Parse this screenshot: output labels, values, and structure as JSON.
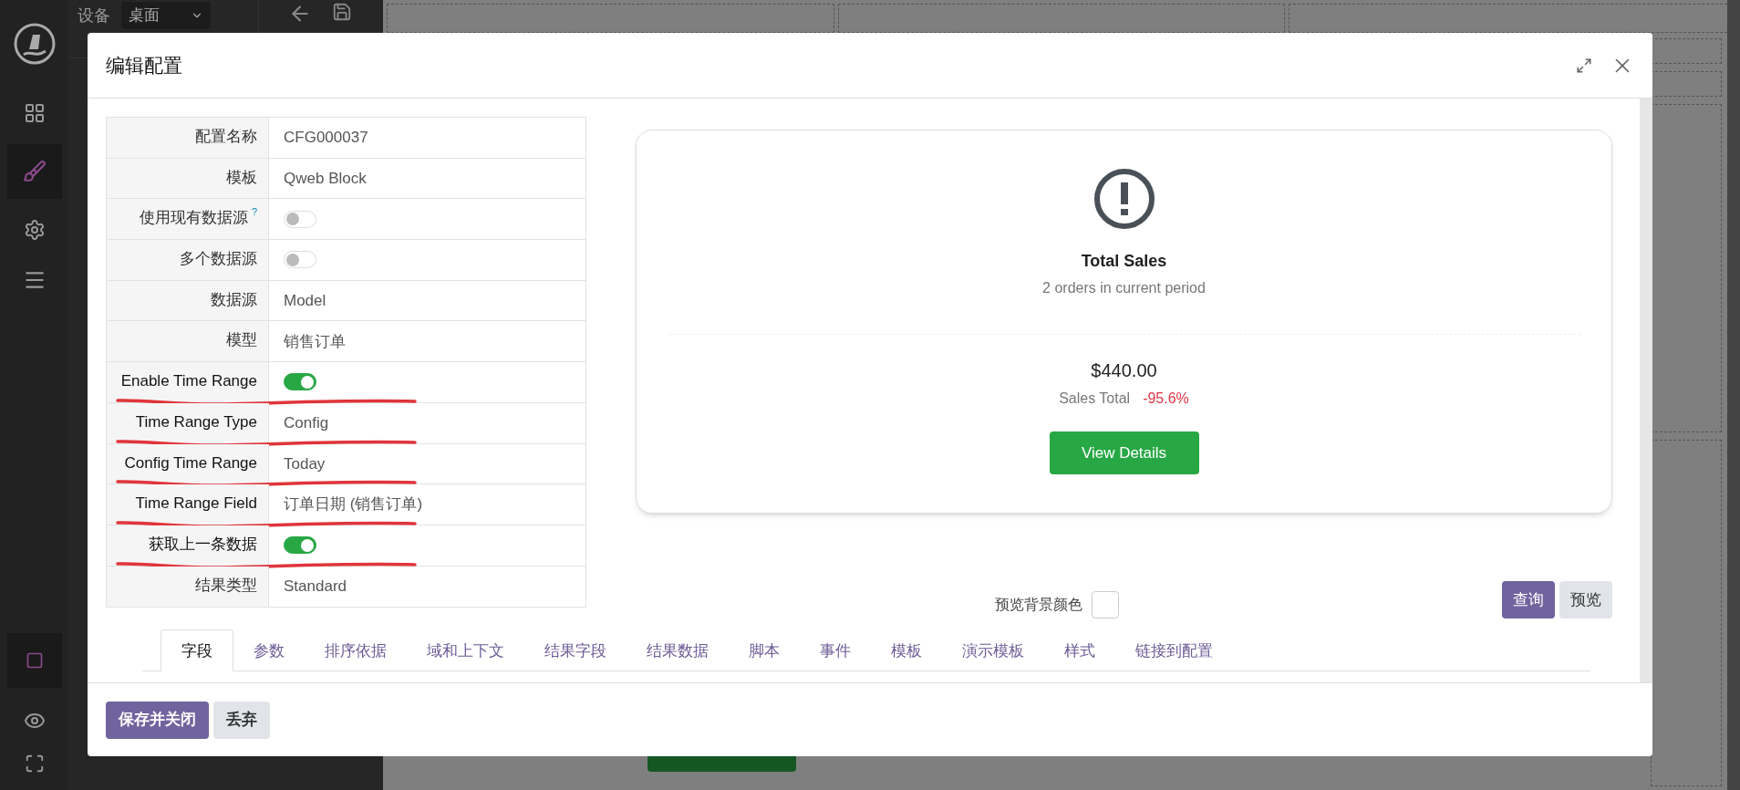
{
  "app": {
    "device_label": "设备",
    "device_value": "桌面"
  },
  "dialog": {
    "title": "编辑配置",
    "form_rows": [
      {
        "label": "配置名称",
        "kind": "text",
        "value": "CFG000037",
        "underlined": false
      },
      {
        "label": "模板",
        "kind": "text",
        "value": "Qweb Block",
        "underlined": false
      },
      {
        "label": "使用现有数据源",
        "help": "?",
        "kind": "toggle",
        "on": false,
        "underlined": false
      },
      {
        "label": "多个数据源",
        "kind": "toggle",
        "on": false,
        "underlined": false
      },
      {
        "label": "数据源",
        "kind": "text",
        "value": "Model",
        "underlined": false
      },
      {
        "label": "模型",
        "kind": "text",
        "value": "销售订单",
        "underlined": false
      },
      {
        "label": "Enable Time Range",
        "kind": "toggle",
        "on": true,
        "underlined": true
      },
      {
        "label": "Time Range Type",
        "kind": "text",
        "value": "Config",
        "underlined": true
      },
      {
        "label": "Config Time Range",
        "kind": "text",
        "value": "Today",
        "underlined": true
      },
      {
        "label": "Time Range Field",
        "kind": "text",
        "value": "订单日期 (销售订单)",
        "underlined": true
      },
      {
        "label": "获取上一条数据",
        "kind": "toggle",
        "on": true,
        "underlined": true
      },
      {
        "label": "结果类型",
        "kind": "text",
        "value": "Standard",
        "underlined": false
      }
    ],
    "preview_card": {
      "title": "Total Sales",
      "subtitle": "2 orders in current period",
      "amount": "$440.00",
      "metric_label": "Sales Total",
      "change": "-95.6%",
      "button": "View Details"
    },
    "preview_bg_label": "预览背景颜色",
    "action_buttons": [
      {
        "label": "查询",
        "kind": "primary"
      },
      {
        "label": "预览",
        "kind": "secondary"
      }
    ],
    "tabs": [
      {
        "label": "字段",
        "selected": true
      },
      {
        "label": "参数",
        "selected": false
      },
      {
        "label": "排序依据",
        "selected": false
      },
      {
        "label": "域和上下文",
        "selected": false
      },
      {
        "label": "结果字段",
        "selected": false
      },
      {
        "label": "结果数据",
        "selected": false
      },
      {
        "label": "脚本",
        "selected": false
      },
      {
        "label": "事件",
        "selected": false
      },
      {
        "label": "模板",
        "selected": false
      },
      {
        "label": "演示模板",
        "selected": false
      },
      {
        "label": "样式",
        "selected": false
      },
      {
        "label": "链接到配置",
        "selected": false
      }
    ],
    "footer_buttons": [
      {
        "label": "保存并关闭",
        "kind": "primary"
      },
      {
        "label": "丢弃",
        "kind": "secondary"
      }
    ]
  }
}
